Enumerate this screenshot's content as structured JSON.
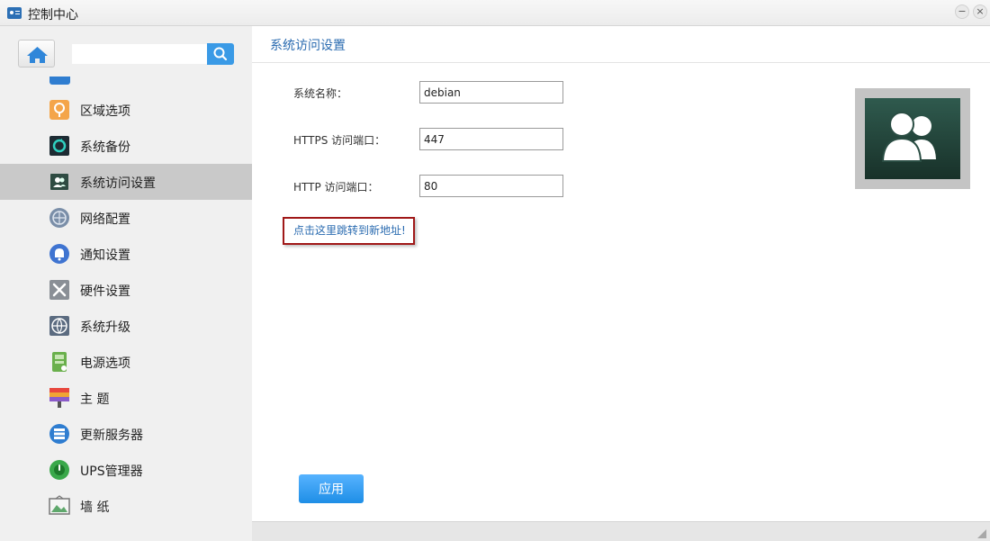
{
  "window": {
    "title": "控制中心",
    "minimize_glyph": "−",
    "close_glyph": "×"
  },
  "sidebar": {
    "search": {
      "placeholder": "",
      "value": ""
    },
    "items": [
      {
        "label": "区域选项",
        "icon": "region-icon"
      },
      {
        "label": "系统备份",
        "icon": "backup-icon"
      },
      {
        "label": "系统访问设置",
        "icon": "access-icon",
        "active": true
      },
      {
        "label": "网络配置",
        "icon": "network-icon"
      },
      {
        "label": "通知设置",
        "icon": "notification-icon"
      },
      {
        "label": "硬件设置",
        "icon": "hardware-icon"
      },
      {
        "label": "系统升级",
        "icon": "upgrade-icon"
      },
      {
        "label": "电源选项",
        "icon": "power-icon"
      },
      {
        "label": "主 题",
        "icon": "theme-icon"
      },
      {
        "label": "更新服务器",
        "icon": "update-server-icon"
      },
      {
        "label": "UPS管理器",
        "icon": "ups-icon"
      },
      {
        "label": "墙 纸",
        "icon": "wallpaper-icon"
      }
    ]
  },
  "main": {
    "title": "系统访问设置",
    "fields": {
      "system_name": {
        "label": "系统名称：",
        "value": "debian"
      },
      "https_port": {
        "label": "HTTPS 访问端口：",
        "value": "447"
      },
      "http_port": {
        "label": "HTTP 访问端口：",
        "value": "80"
      }
    },
    "jump_link": "点击这里跳转到新地址!",
    "apply_button": "应用"
  },
  "colors": {
    "accent": "#2a6bb0",
    "button_blue": "#1e8ee6",
    "highlight_border": "#a01818",
    "sidebar_bg": "#f0f0f0",
    "active_item_bg": "#c9c9c9"
  }
}
